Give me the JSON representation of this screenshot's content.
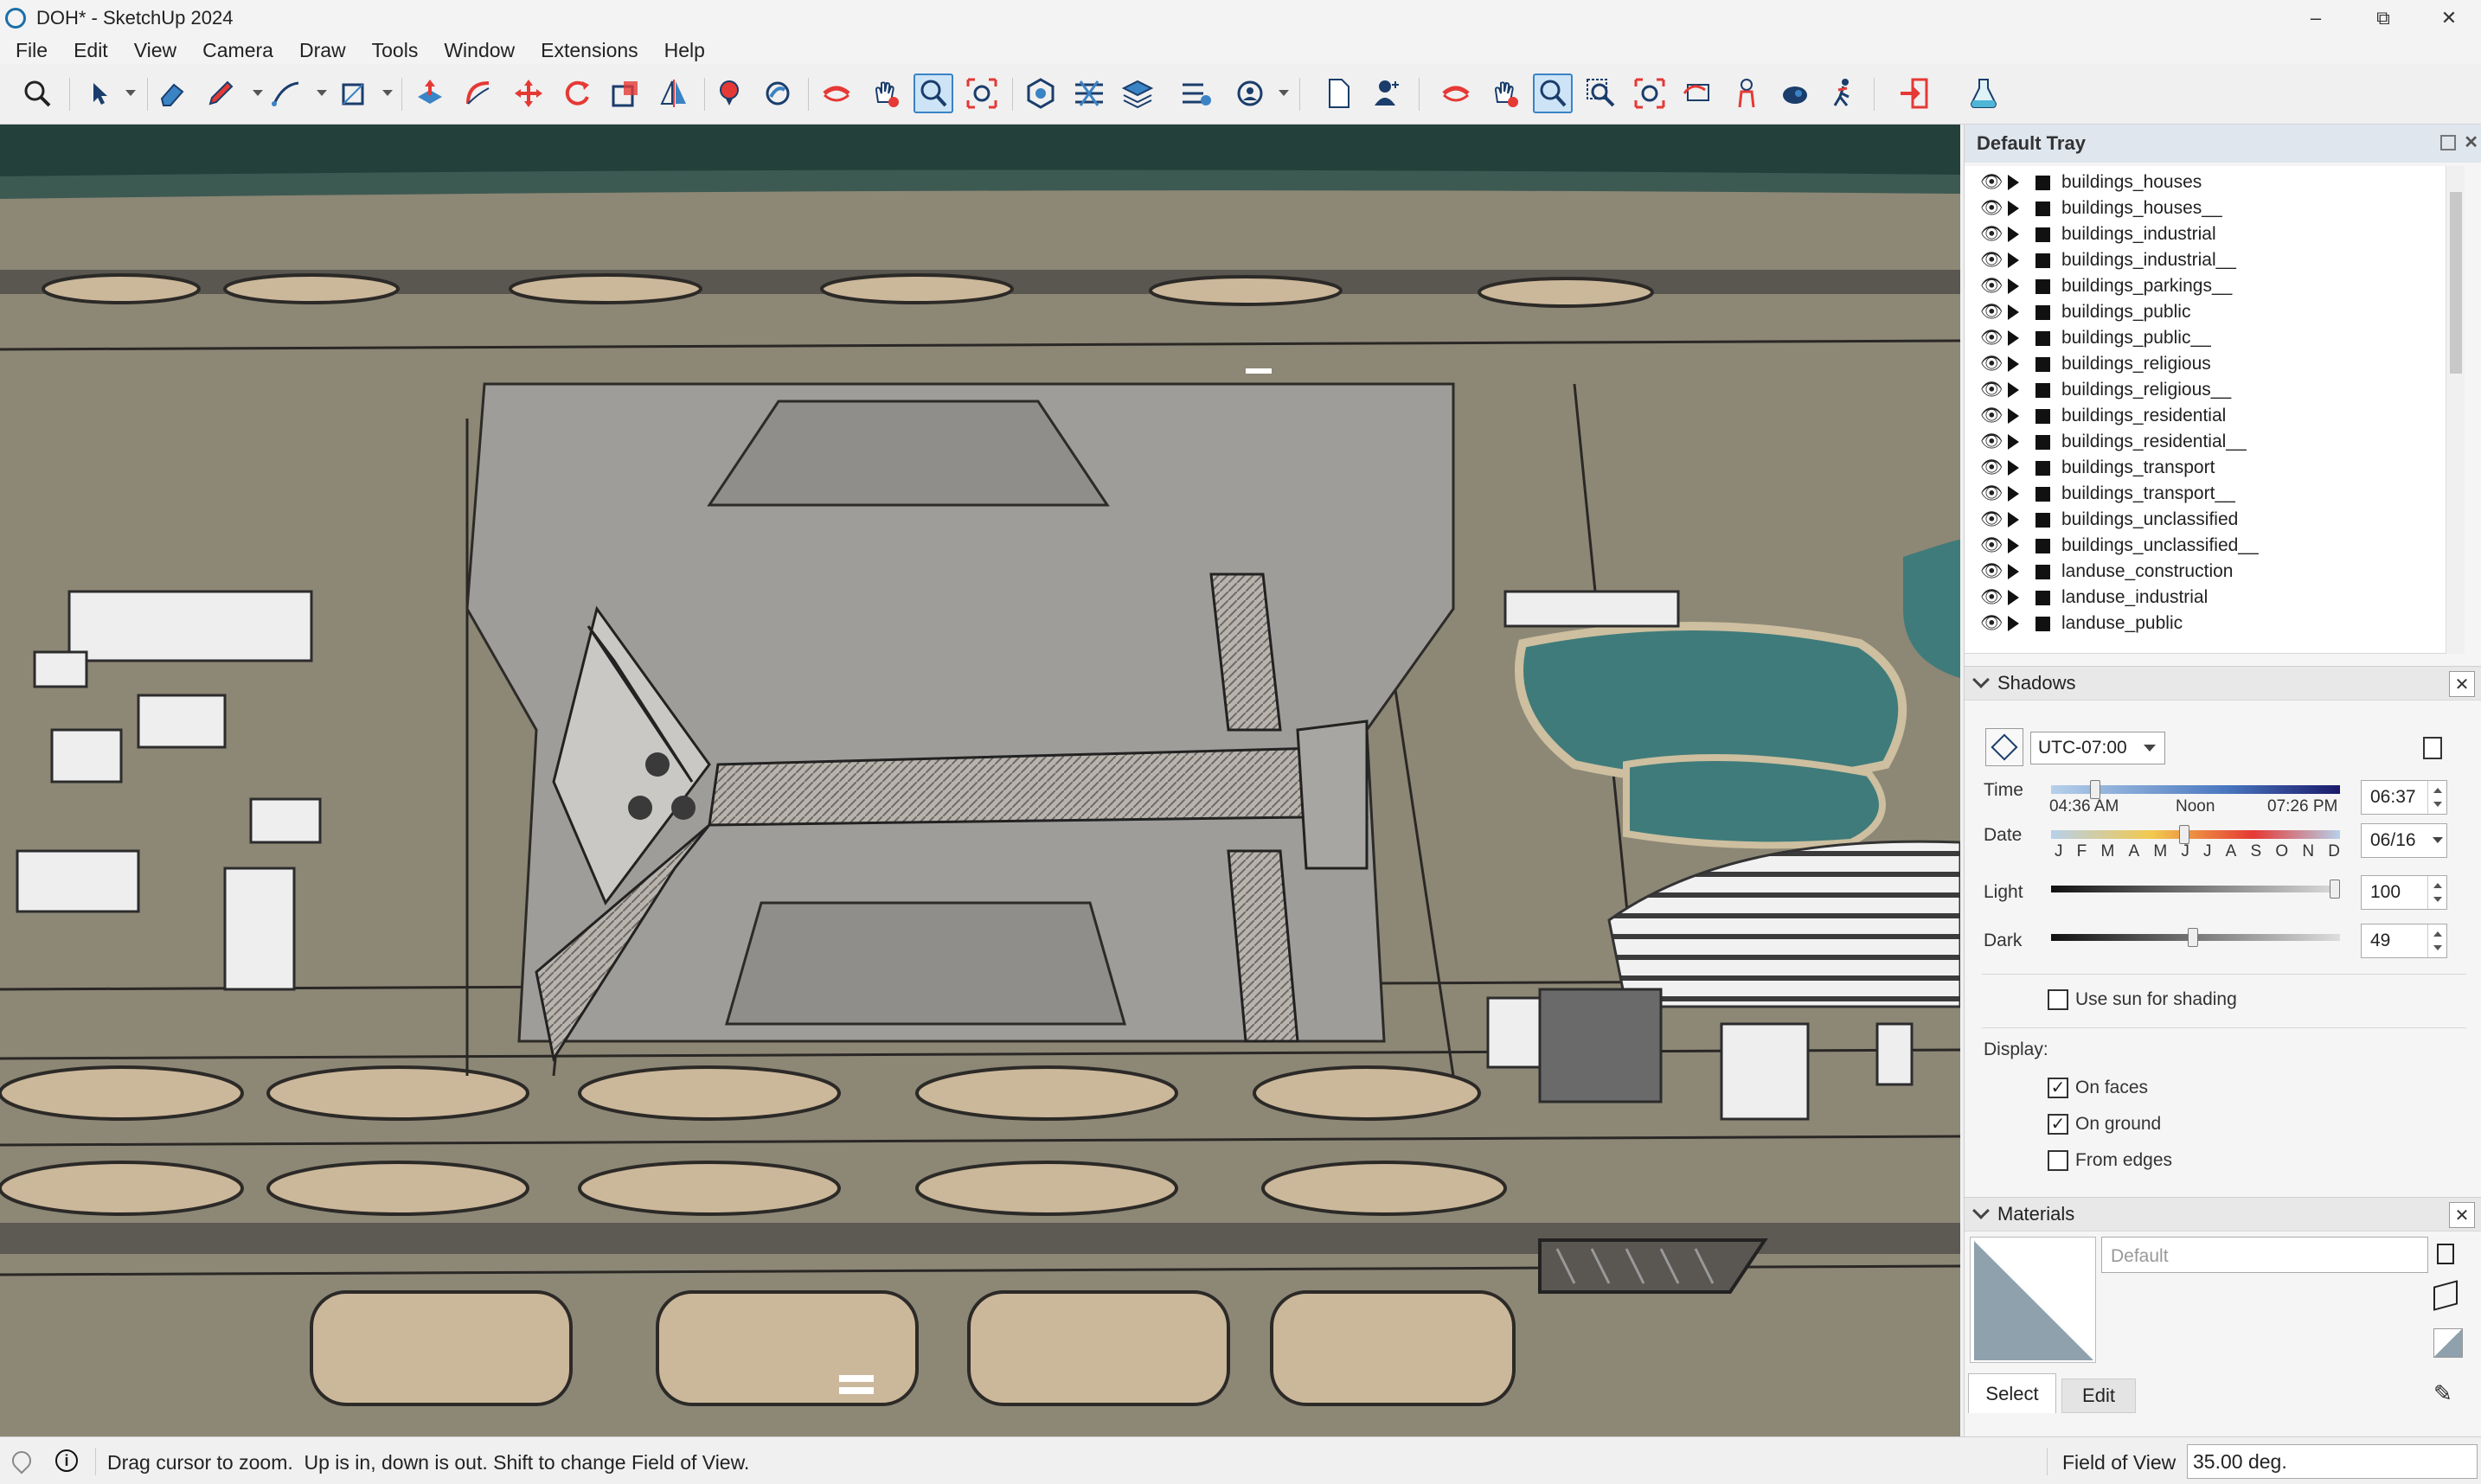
{
  "window": {
    "title": "DOH* - SketchUp 2024",
    "controls": {
      "minimize": "–",
      "maximize": "⧉",
      "close": "✕"
    }
  },
  "menu": [
    "File",
    "Edit",
    "View",
    "Camera",
    "Draw",
    "Tools",
    "Window",
    "Extensions",
    "Help"
  ],
  "toolbar": {
    "tools": [
      "search-icon",
      "select-arrow-icon",
      "eraser-icon",
      "pencil-icon",
      "line-icon",
      "rectangle-icon",
      "push-pull-icon",
      "follow-me-icon",
      "move-icon",
      "rotate-icon",
      "scale-icon",
      "flip-icon",
      "paint-bucket-icon",
      "tape-icon",
      "orbit-icon",
      "pan-icon",
      "zoom-icon",
      "zoom-extents-icon",
      "solid-tools-icon",
      "sections-icon",
      "layers-icon",
      "outliner-icon",
      "warehouse-icon",
      "new-file-icon",
      "person-add-icon",
      "orbit-icon",
      "pan-icon",
      "zoom-icon",
      "zoom-window-icon",
      "zoom-extents-icon",
      "previous-view-icon",
      "position-camera-icon",
      "look-around-icon",
      "walk-icon",
      "export-icon",
      "extension-flask-icon"
    ],
    "active_tools": [
      "zoom-icon"
    ]
  },
  "tray": {
    "title": "Default Tray",
    "layers": [
      "buildings_houses",
      "buildings_houses__",
      "buildings_industrial",
      "buildings_industrial__",
      "buildings_parkings__",
      "buildings_public",
      "buildings_public__",
      "buildings_religious",
      "buildings_religious__",
      "buildings_residential",
      "buildings_residential__",
      "buildings_transport",
      "buildings_transport__",
      "buildings_unclassified",
      "buildings_unclassified__",
      "landuse_construction",
      "landuse_industrial",
      "landuse_public"
    ]
  },
  "shadows": {
    "title": "Shadows",
    "timezone": "UTC-07:00",
    "time_label": "Time",
    "time_start": "04:36 AM",
    "time_mid": "Noon",
    "time_end": "07:26 PM",
    "time_value": "06:37",
    "time_fraction": 0.14,
    "date_label": "Date",
    "months": [
      "J",
      "F",
      "M",
      "A",
      "M",
      "J",
      "J",
      "A",
      "S",
      "O",
      "N",
      "D"
    ],
    "date_value": "06/16",
    "date_fraction": 0.46,
    "light_label": "Light",
    "light_value": "100",
    "light_fraction": 1.0,
    "dark_label": "Dark",
    "dark_value": "49",
    "dark_fraction": 0.49,
    "use_sun_label": "Use sun for shading",
    "use_sun_checked": false,
    "display_label": "Display:",
    "on_faces_label": "On faces",
    "on_faces_checked": true,
    "on_ground_label": "On ground",
    "on_ground_checked": true,
    "from_edges_label": "From edges",
    "from_edges_checked": false
  },
  "materials": {
    "title": "Materials",
    "name_placeholder": "Default",
    "tab_select": "Select",
    "tab_edit": "Edit"
  },
  "status": {
    "message": "Drag cursor to zoom.  Up is in, down is out. Shift to change Field of View.",
    "measure_label": "Field of View",
    "measure_value": "35.00 deg."
  },
  "colors": {
    "accent": "#3a83c5",
    "tray_header": "#dfe6ee",
    "ground": "#8b8574",
    "water": "#3f7b7a"
  }
}
